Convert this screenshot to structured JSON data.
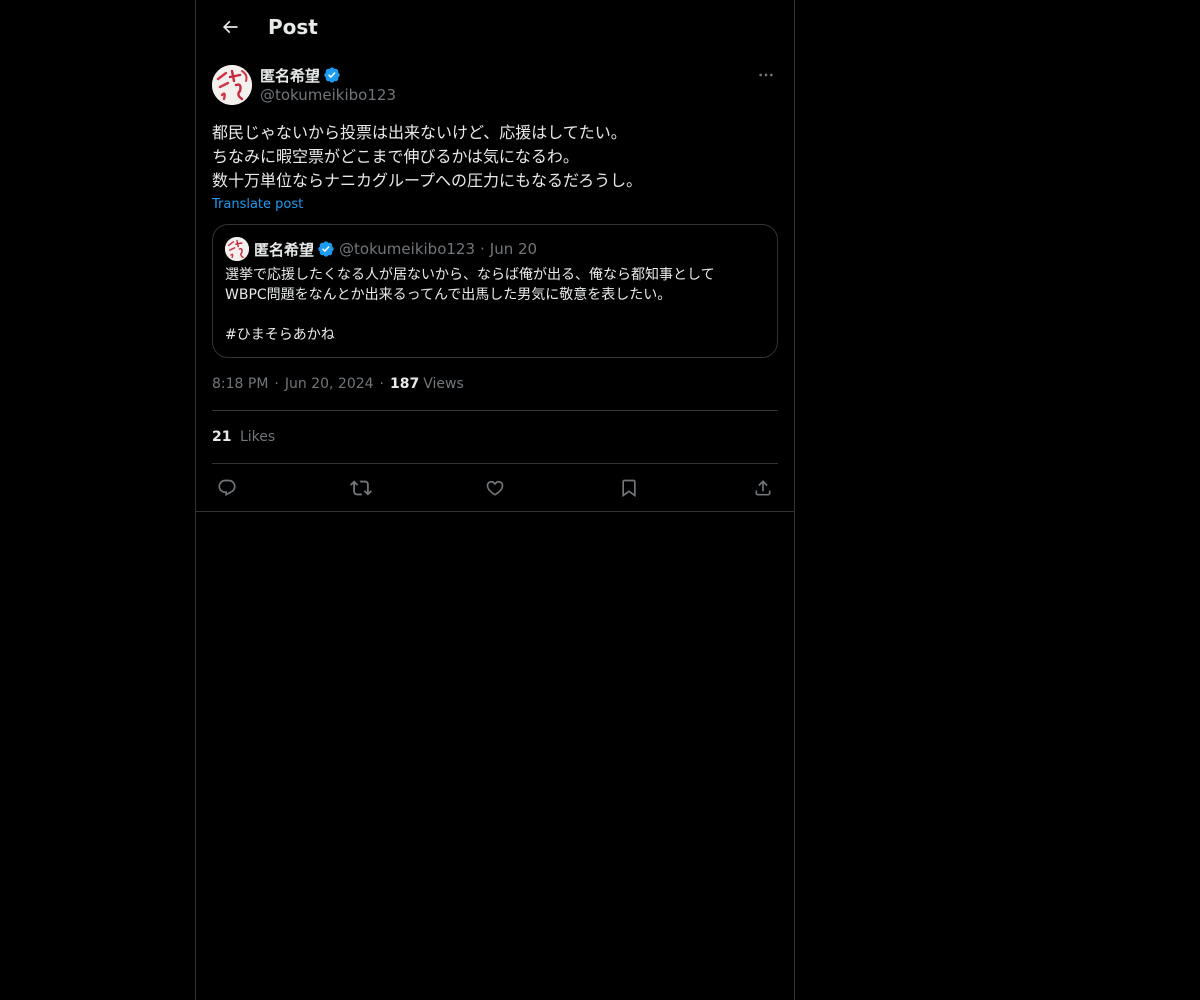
{
  "header": {
    "title": "Post"
  },
  "post": {
    "author": {
      "display_name": "匿名希望",
      "handle": "@tokumeikibo123"
    },
    "text_lines": [
      "都民じゃないから投票は出来ないけど、応援はしてたい。",
      "ちなみに暇空票がどこまで伸びるかは気になるわ。",
      "数十万単位ならナニカグループへの圧力にもなるだろうし。"
    ],
    "translate_label": "Translate post",
    "quote": {
      "author": {
        "display_name": "匿名希望",
        "handle": "@tokumeikibo123"
      },
      "dot": "·",
      "date": "Jun 20",
      "text_lines": [
        "選挙で応援したくなる人が居ないから、ならば俺が出る、俺なら都知事として",
        "WBPC問題をなんとか出来るってんで出馬した男気に敬意を表したい。",
        "",
        "#ひまそらあかね"
      ]
    },
    "meta": {
      "time": "8:18 PM",
      "separator": "·",
      "date": "Jun 20, 2024",
      "views_count": "187",
      "views_label": "Views"
    },
    "stats": {
      "likes_count": "21",
      "likes_label": "Likes"
    },
    "actions": [
      "reply-icon",
      "repost-icon",
      "like-icon",
      "bookmark-icon",
      "share-icon"
    ]
  },
  "colors": {
    "background": "#000000",
    "text": "#e7e9ea",
    "secondary": "#71767b",
    "accent": "#1d9bf0",
    "border": "#2f3336"
  }
}
